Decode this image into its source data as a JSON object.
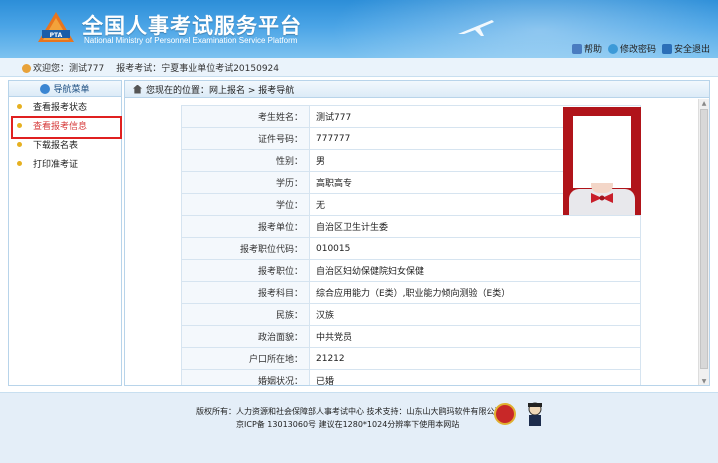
{
  "header": {
    "title": "全国人事考试服务平台",
    "subtitle": "National Ministry of Personnel Examination Service Platform",
    "logo_text": "PTA",
    "links": [
      {
        "label": "帮助",
        "icon": "lock-icon"
      },
      {
        "label": "修改密码",
        "icon": "help-icon"
      },
      {
        "label": "安全退出",
        "icon": "exit-icon"
      }
    ]
  },
  "infobar": {
    "welcome": "欢迎您：测试777",
    "exam": "报考考试：宁夏事业单位考试20150924"
  },
  "sidebar": {
    "title": "导航菜单",
    "items": [
      {
        "label": "查看报考状态"
      },
      {
        "label": "查看报考信息",
        "active": true
      },
      {
        "label": "下载报名表"
      },
      {
        "label": "打印准考证"
      }
    ]
  },
  "breadcrumb": {
    "text": "您现在的位置：网上报名 > 报考导航"
  },
  "profile": {
    "rows": [
      {
        "key": "考生姓名：",
        "value": "测试777"
      },
      {
        "key": "证件号码：",
        "value": "777777"
      },
      {
        "key": "性别：",
        "value": "男"
      },
      {
        "key": "学历：",
        "value": "高职高专"
      },
      {
        "key": "学位：",
        "value": "无"
      },
      {
        "key": "报考单位：",
        "value": "自治区卫生计生委"
      },
      {
        "key": "报考职位代码：",
        "value": "010015"
      },
      {
        "key": "报考职位：",
        "value": "自治区妇幼保健院妇女保健"
      },
      {
        "key": "报考科目：",
        "value": "综合应用能力（E类）,职业能力倾向测验（E类）"
      },
      {
        "key": "民族：",
        "value": "汉族"
      },
      {
        "key": "政治面貌：",
        "value": "中共党员"
      },
      {
        "key": "户口所在地：",
        "value": "21212"
      },
      {
        "key": "婚姻状况：",
        "value": "已婚"
      }
    ]
  },
  "footer": {
    "line1": "版权所有：人力资源和社会保障部人事考试中心  技术支持：山东山大鸥玛软件有限公司",
    "line2": "京ICP备 13013060号  建议在1280*1024分辨率下使用本网站"
  },
  "colors": {
    "header_blue": "#2c8ed8",
    "active_red": "#e02020"
  }
}
